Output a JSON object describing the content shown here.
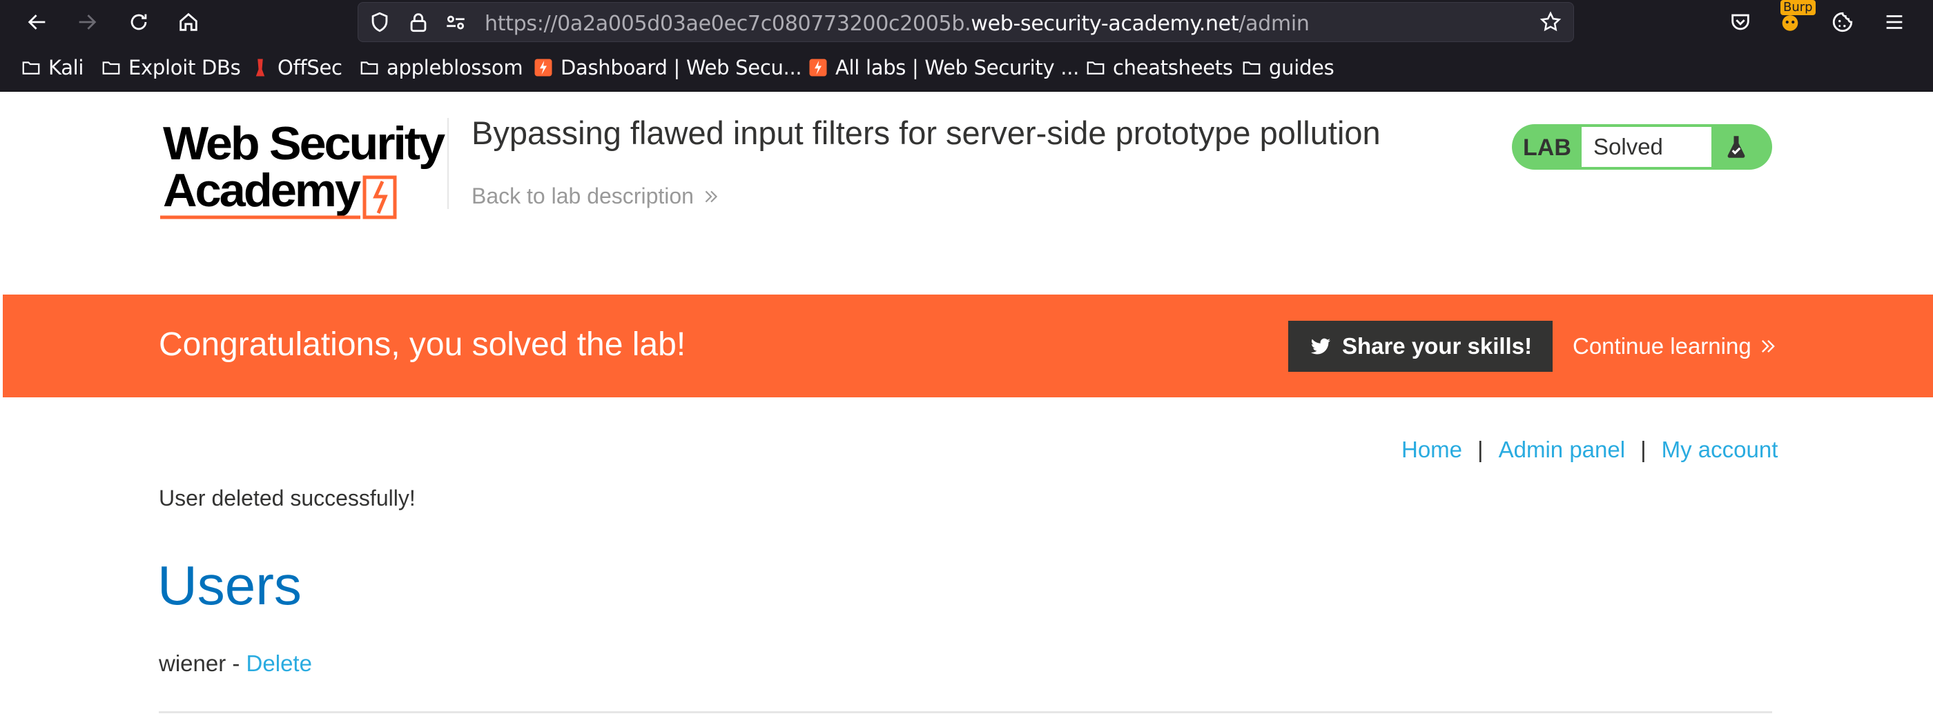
{
  "browser": {
    "url_prefix": "https://0a2a005d03ae0ec7c080773200c2005b.",
    "url_domain": "web-security-academy.net",
    "url_path": "/admin",
    "extension_badge": "Burp",
    "bookmarks": [
      {
        "label": "Kali",
        "icon": "folder-icon"
      },
      {
        "label": "Exploit DBs",
        "icon": "folder-icon"
      },
      {
        "label": "OffSec",
        "icon": "offsec-icon"
      },
      {
        "label": "appleblossom",
        "icon": "folder-icon"
      },
      {
        "label": "Dashboard | Web Secu...",
        "icon": "portswigger-icon"
      },
      {
        "label": "All labs | Web Security ...",
        "icon": "portswigger-icon"
      },
      {
        "label": "cheatsheets",
        "icon": "folder-icon"
      },
      {
        "label": "guides",
        "icon": "folder-icon"
      }
    ]
  },
  "header": {
    "logo_line1": "Web Security",
    "logo_line2": "Academy",
    "lab_title": "Bypassing flawed input filters for server-side prototype pollution",
    "back_link": "Back to lab description",
    "lab_badge": {
      "label": "LAB",
      "status": "Solved"
    }
  },
  "banner": {
    "message": "Congratulations, you solved the lab!",
    "share_label": "Share your skills!",
    "continue_label": "Continue learning"
  },
  "nav": {
    "home": "Home",
    "admin": "Admin panel",
    "account": "My account",
    "separator": "|"
  },
  "main": {
    "message": "User deleted successfully!",
    "heading": "Users",
    "users": [
      {
        "name": "wiener",
        "separator": " - ",
        "action": "Delete"
      }
    ]
  },
  "colors": {
    "accent_orange": "#ff6633",
    "lab_green": "#70d16d",
    "link_blue": "#29abe0",
    "heading_blue": "#0071bc"
  }
}
